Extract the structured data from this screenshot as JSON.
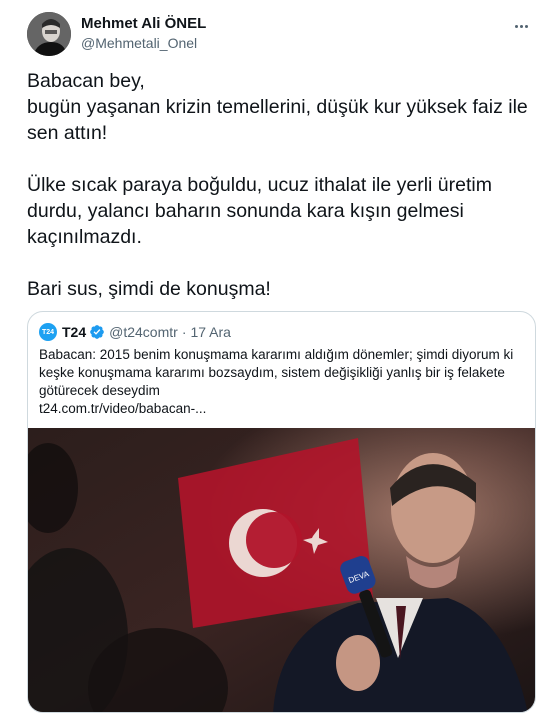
{
  "author": {
    "display_name": "Mehmet Ali ÖNEL",
    "handle": "@Mehmetali_Onel"
  },
  "tweet": {
    "lines": [
      "Babacan bey,",
      "bugün yaşanan krizin temellerini, düşük kur yüksek faiz ile sen attın!",
      "Ülke sıcak paraya boğuldu, ucuz ithalat ile yerli üretim durdu, yalancı baharın sonunda kara kışın gelmesi kaçınılmazdı.",
      "Bari sus, şimdi de konuşma!"
    ]
  },
  "quoted": {
    "logo_text": "T24",
    "name": "T24",
    "handle": "@t24comtr",
    "separator": "·",
    "date": "17 Ara",
    "text": "Babacan: 2015 benim konuşmama kararımı aldığım dönemler; şimdi diyorum ki keşke konuşmama kararımı bozsaydım, sistem değişikliği yanlış bir iş felakete götürecek deseydim",
    "link": "t24.com.tr/video/babacan-...",
    "mic_label": "DEVA"
  },
  "colors": {
    "accent": "#1d9bf0",
    "flag_red": "#c8102e"
  },
  "icons": {
    "verified": "verified-badge-icon",
    "more": "more-options-icon"
  }
}
